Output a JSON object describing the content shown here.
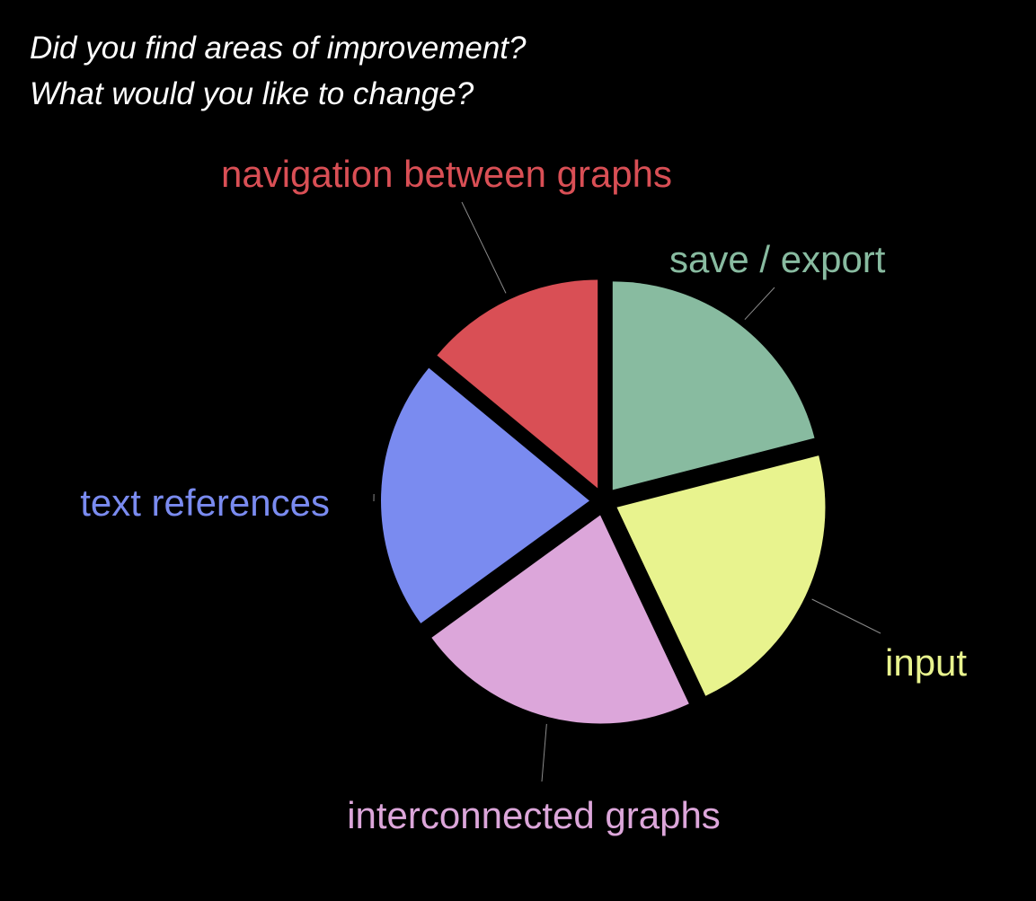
{
  "question": {
    "line1": "Did you find areas of improvement?",
    "line2": "What would you like to change?"
  },
  "chart_data": {
    "type": "pie",
    "slices": [
      {
        "label": "save / export",
        "value": 21,
        "color": "#88bba0"
      },
      {
        "label": "input",
        "value": 22,
        "color": "#e8f38e"
      },
      {
        "label": "interconnected graphs",
        "value": 22,
        "color": "#dca6da"
      },
      {
        "label": "text references",
        "value": 21,
        "color": "#7a8bf0"
      },
      {
        "label": "navigation between graphs",
        "value": 14,
        "color": "#d94f55"
      }
    ]
  }
}
